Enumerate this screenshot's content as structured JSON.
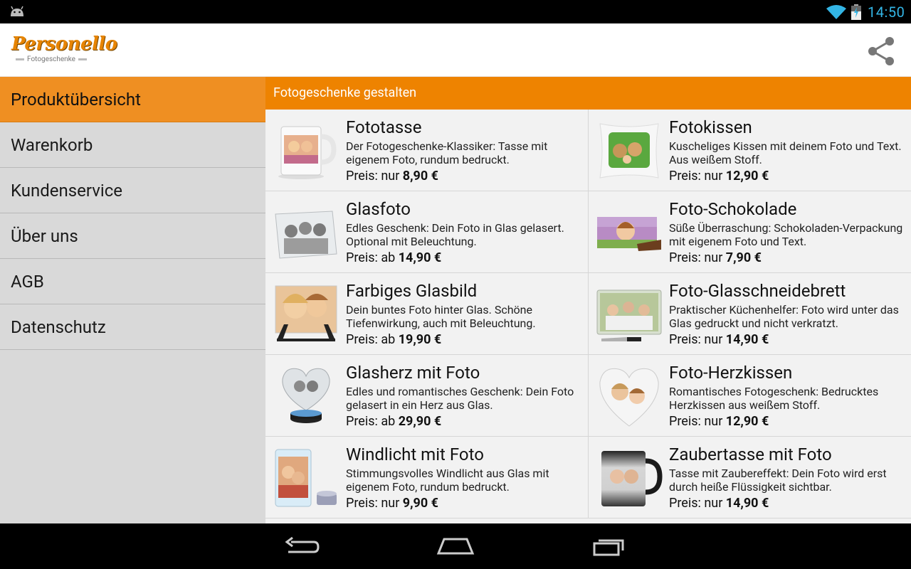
{
  "status_bar": {
    "time": "14:50"
  },
  "app": {
    "logo_text": "Personello",
    "logo_subtitle": "Fotogeschenke"
  },
  "drawer": {
    "items": [
      {
        "label": "Produktübersicht",
        "active": true
      },
      {
        "label": "Warenkorb",
        "active": false
      },
      {
        "label": "Kundenservice",
        "active": false
      },
      {
        "label": "Über uns",
        "active": false
      },
      {
        "label": "AGB",
        "active": false
      },
      {
        "label": "Datenschutz",
        "active": false
      }
    ]
  },
  "content": {
    "header": "Fotogeschenke gestalten",
    "products": [
      {
        "title": "Fototasse",
        "description": "Der Fotogeschenke-Klassiker: Tasse mit eigenem Foto, rundum bedruckt.",
        "price_prefix": "Preis: nur ",
        "price": "8,90 €",
        "thumb": "mug-thumb"
      },
      {
        "title": "Fotokissen",
        "description": "Kuscheliges Kissen mit deinem Foto und Text. Aus weißem Stoff.",
        "price_prefix": "Preis: nur ",
        "price": "12,90 €",
        "thumb": "pillow-thumb"
      },
      {
        "title": "Glasfoto",
        "description": "Edles Geschenk: Dein Foto in Glas gelasert. Optional mit Beleuchtung.",
        "price_prefix": "Preis: ab ",
        "price": "14,90 €",
        "thumb": "glass-block-thumb"
      },
      {
        "title": "Foto-Schokolade",
        "description": "Süße Überraschung: Schokoladen-Verpackung mit eigenem Foto und Text.",
        "price_prefix": "Preis: nur ",
        "price": "7,90 €",
        "thumb": "chocolate-thumb"
      },
      {
        "title": "Farbiges Glasbild",
        "description": "Dein buntes Foto hinter Glas. Schöne Tiefenwirkung, auch mit Beleuchtung.",
        "price_prefix": "Preis: ab ",
        "price": "19,90 €",
        "thumb": "glass-picture-thumb"
      },
      {
        "title": "Foto-Glasschneidebrett",
        "description": "Praktischer Küchenhelfer: Foto wird unter das Glas gedruckt und nicht verkratzt.",
        "price_prefix": "Preis: nur ",
        "price": "14,90 €",
        "thumb": "cutting-board-thumb"
      },
      {
        "title": "Glasherz mit Foto",
        "description": "Edles und romantisches Geschenk: Dein Foto gelasert in ein Herz aus Glas.",
        "price_prefix": "Preis: ab ",
        "price": "29,90 €",
        "thumb": "glass-heart-thumb"
      },
      {
        "title": "Foto-Herzkissen",
        "description": "Romantisches Fotogeschenk: Bedrucktes Herzkissen aus weißem Stoff.",
        "price_prefix": "Preis: nur ",
        "price": "12,90 €",
        "thumb": "heart-pillow-thumb"
      },
      {
        "title": "Windlicht mit Foto",
        "description": "Stimmungsvolles Windlicht aus Glas mit eigenem Foto, rundum bedruckt.",
        "price_prefix": "Preis: nur ",
        "price": "9,90 €",
        "thumb": "lantern-thumb"
      },
      {
        "title": "Zaubertasse mit Foto",
        "description": "Tasse mit Zaubereffekt: Dein Foto wird erst durch heiße Flüssigkeit sichtbar.",
        "price_prefix": "Preis: nur ",
        "price": "14,90 €",
        "thumb": "magic-mug-thumb"
      }
    ]
  },
  "colors": {
    "accent": "#ee8300",
    "drawer_active": "#ef8f22",
    "status_accent": "#33b5e5"
  }
}
